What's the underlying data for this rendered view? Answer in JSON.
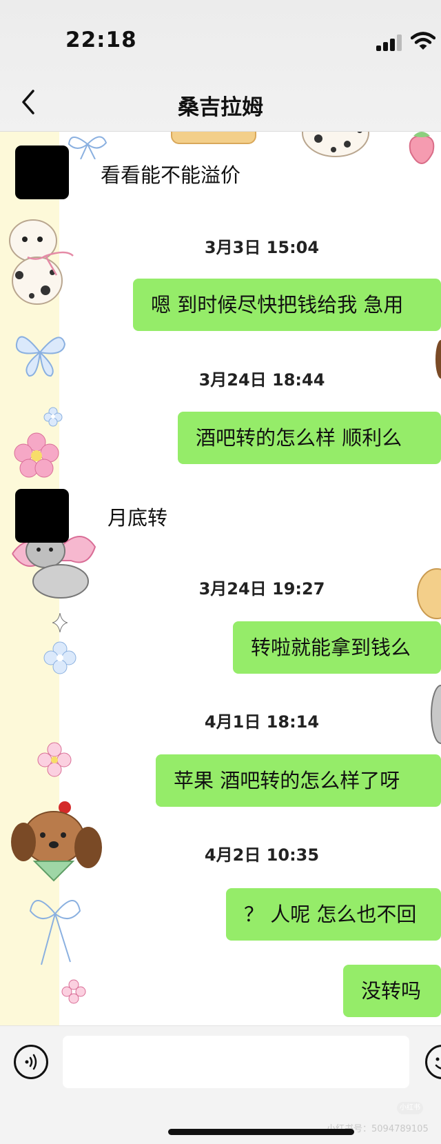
{
  "status_bar": {
    "time": "22:18"
  },
  "nav": {
    "title": "桑吉拉姆"
  },
  "messages": [
    {
      "kind": "incoming",
      "text": "看看能不能溢价"
    },
    {
      "kind": "timestamp",
      "text": "3月3日 15:04"
    },
    {
      "kind": "outgoing",
      "text": "嗯 到时候尽快把钱给我 急用"
    },
    {
      "kind": "timestamp",
      "text": "3月24日 18:44"
    },
    {
      "kind": "outgoing",
      "text": "酒吧转的怎么样 顺利么"
    },
    {
      "kind": "incoming",
      "text": "月底转"
    },
    {
      "kind": "timestamp",
      "text": "3月24日 19:27"
    },
    {
      "kind": "outgoing",
      "text": "转啦就能拿到钱么"
    },
    {
      "kind": "timestamp",
      "text": "4月1日 18:14"
    },
    {
      "kind": "outgoing",
      "text": "苹果 酒吧转的怎么样了呀"
    },
    {
      "kind": "timestamp",
      "text": "4月2日 10:35"
    },
    {
      "kind": "outgoing",
      "text": "？ 人呢 怎么也不回"
    },
    {
      "kind": "outgoing",
      "text": "没转吗"
    }
  ],
  "watermark": {
    "text": "小红书号：5094789105",
    "logo": "小红书"
  },
  "icons": [
    "back-chevron-icon",
    "signal-icon",
    "wifi-icon",
    "voice-icon",
    "emoji-icon"
  ],
  "colors": {
    "outgoing_bubble": "#95ec69",
    "wallpaper_strip": "#fdf9d9",
    "header_bg": "#efefef"
  }
}
